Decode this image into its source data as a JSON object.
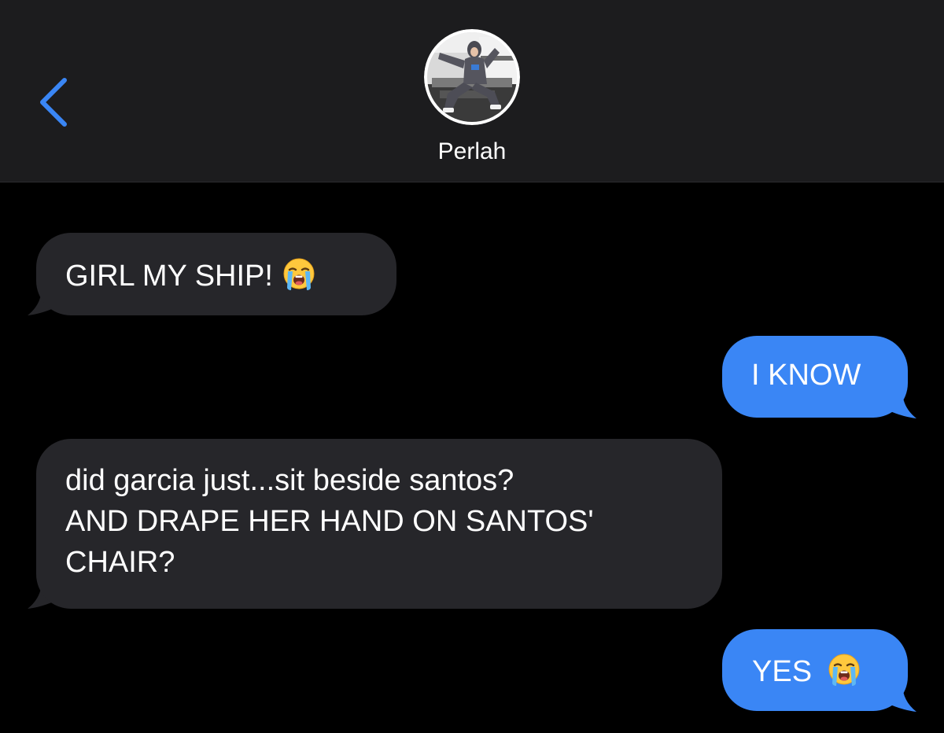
{
  "header": {
    "back_icon": "chevron-left-icon",
    "contact_name": "Perlah",
    "colors": {
      "background": "#1c1c1e",
      "accent": "#3a86f5",
      "text": "#ffffff"
    }
  },
  "messages": [
    {
      "direction": "received",
      "text": "GIRL MY SHIP!",
      "emoji": "loudly-crying-face"
    },
    {
      "direction": "sent",
      "text": "I KNOW"
    },
    {
      "direction": "received",
      "lines": [
        "did garcia just...sit beside santos?",
        "AND DRAPE HER HAND ON SANTOS'",
        "CHAIR?"
      ]
    },
    {
      "direction": "sent",
      "text": "YES",
      "emoji": "loudly-crying-face"
    }
  ],
  "colors": {
    "thread_background": "#000000",
    "received_bubble": "#26262a",
    "sent_bubble": "#3a86f5"
  }
}
